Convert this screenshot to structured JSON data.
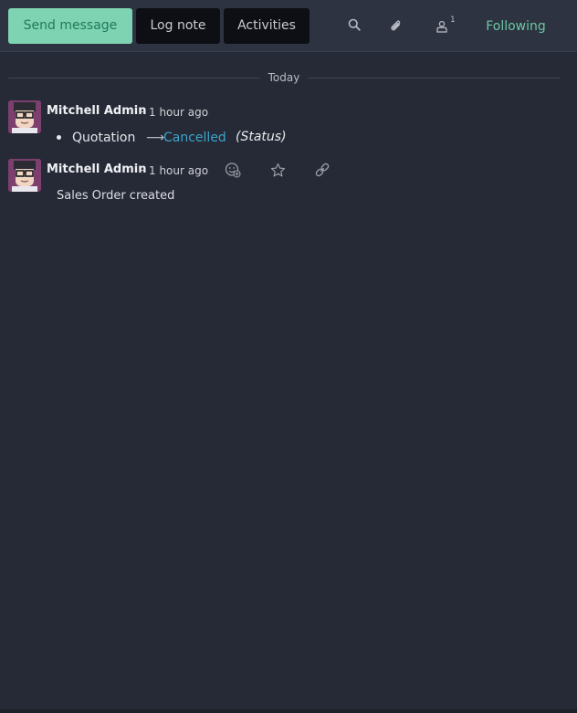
{
  "composer": {
    "send_message_label": "Send message",
    "log_note_label": "Log note",
    "activities_label": "Activities"
  },
  "topbar": {
    "search_icon": "search-icon",
    "attachment_icon": "paperclip-icon",
    "followers_icon": "user-icon",
    "followers_count": "1",
    "following_label": "Following"
  },
  "separator": {
    "label": "Today"
  },
  "messages": [
    {
      "author": "Mitchell Admin",
      "dash": "-",
      "time": "1 hour ago",
      "tracking": {
        "field": "Quotation",
        "arrow": "⟶",
        "new_value": "Cancelled",
        "field_label": "(Status)"
      }
    },
    {
      "author": "Mitchell Admin",
      "dash": "-",
      "time": "1 hour ago",
      "body": "Sales Order created",
      "actions": [
        "add-reaction-icon",
        "star-icon",
        "link-icon"
      ]
    }
  ],
  "colors": {
    "background": "#262a36",
    "topbar": "#2e3341",
    "primary_button": "#7ed3b2",
    "accent_green": "#6bc6a4",
    "link_blue": "#3ba4cb"
  }
}
